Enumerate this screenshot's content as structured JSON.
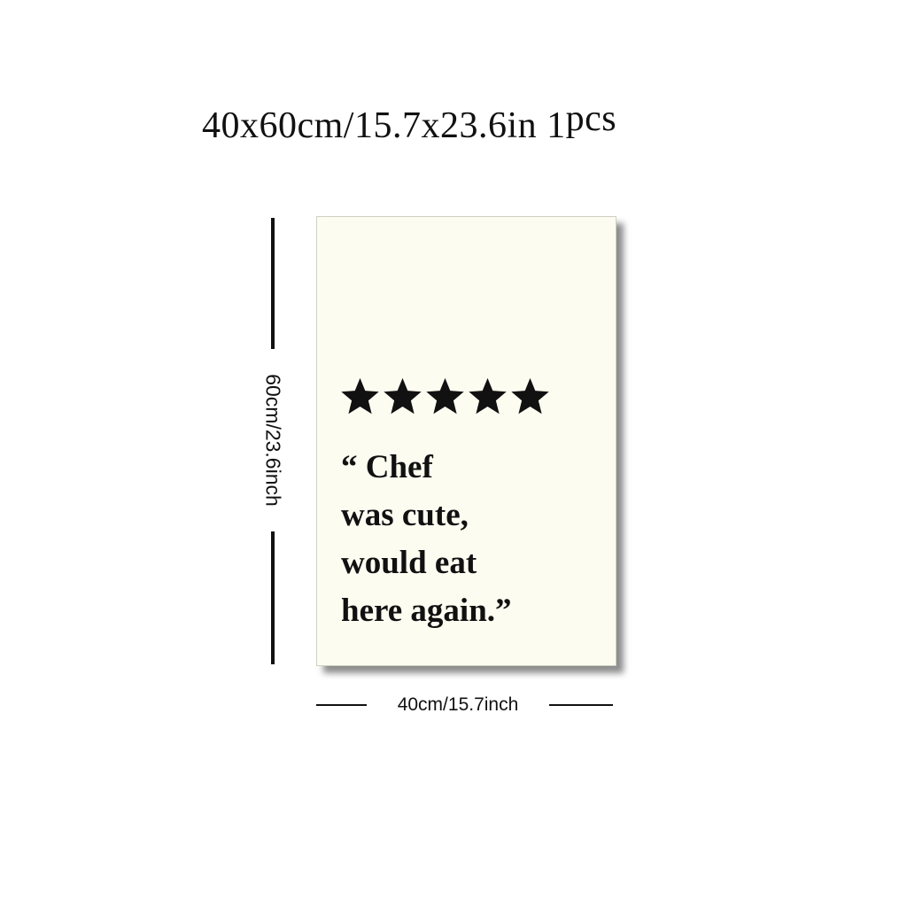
{
  "header": {
    "size_text": "40x60cm/15.7x23.6in 1",
    "qty_text": "pcs"
  },
  "dimensions": {
    "height_label": "60cm/23.6inch",
    "width_label": "40cm/15.7inch"
  },
  "poster": {
    "background_color": "#fcfcf1",
    "rating": 5,
    "rating_max": 5,
    "star_icon": "star-icon",
    "quote_lines": [
      "“ Chef",
      "was cute,",
      "would eat",
      "here again.”"
    ]
  }
}
